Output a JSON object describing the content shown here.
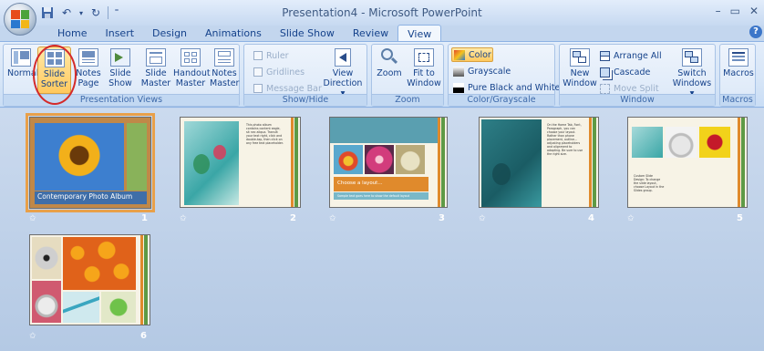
{
  "window": {
    "title": "Presentation4 - Microsoft PowerPoint",
    "controls": [
      "–",
      "▭",
      "✕"
    ]
  },
  "quick_access": [
    "save-icon",
    "undo-icon",
    "redo-icon",
    "customize-icon"
  ],
  "tabs": [
    {
      "label": "Home",
      "active": false
    },
    {
      "label": "Insert",
      "active": false
    },
    {
      "label": "Design",
      "active": false
    },
    {
      "label": "Animations",
      "active": false
    },
    {
      "label": "Slide Show",
      "active": false
    },
    {
      "label": "Review",
      "active": false
    },
    {
      "label": "View",
      "active": true
    }
  ],
  "ribbon": {
    "presentation_views": {
      "label": "Presentation Views",
      "normal": "Normal",
      "slide_sorter_1": "Slide",
      "slide_sorter_2": "Sorter",
      "notes_page_1": "Notes",
      "notes_page_2": "Page",
      "slide_show_1": "Slide",
      "slide_show_2": "Show",
      "slide_master_1": "Slide",
      "slide_master_2": "Master",
      "handout_master_1": "Handout",
      "handout_master_2": "Master",
      "notes_master_1": "Notes",
      "notes_master_2": "Master"
    },
    "show_hide": {
      "label": "Show/Hide",
      "ruler": "Ruler",
      "gridlines": "Gridlines",
      "message_bar": "Message Bar",
      "view_direction_1": "View",
      "view_direction_2": "Direction ▾"
    },
    "zoom": {
      "label": "Zoom",
      "zoom": "Zoom",
      "fit_1": "Fit to",
      "fit_2": "Window"
    },
    "color": {
      "label": "Color/Grayscale",
      "color": "Color",
      "grayscale": "Grayscale",
      "bw": "Pure Black and White"
    },
    "window": {
      "label": "Window",
      "new_1": "New",
      "new_2": "Window",
      "arrange": "Arrange All",
      "cascade": "Cascade",
      "move_split": "Move Split",
      "switch_1": "Switch",
      "switch_2": "Windows ▾"
    },
    "macros": {
      "label": "Macros",
      "macros": "Macros"
    }
  },
  "slides": [
    {
      "number": "1",
      "caption": "Contemporary Photo Album"
    },
    {
      "number": "2",
      "body": "This photo album contains content eagle, sit nec aliqua. Translit your text right, click and double-tap, then click on any free text placeholder."
    },
    {
      "number": "3",
      "caption": "Choose a layout...",
      "sub": "Sample text goes here to show the default layout"
    },
    {
      "number": "4",
      "body": "On the Home Tab, Font, Paragraph, you can choose your layout. Rather than phone placement, outline... adjusting placeholders and alignment to adapting. Be sure to use the right size."
    },
    {
      "number": "5",
      "body": "Custom Slide Design: To change the slide layout, choose Layout in the Slides group."
    },
    {
      "number": "6"
    }
  ],
  "colors": {
    "accent_orange": "#e08a2c",
    "accent_green": "#5f9a45",
    "annotation_red": "#d42a2a"
  }
}
